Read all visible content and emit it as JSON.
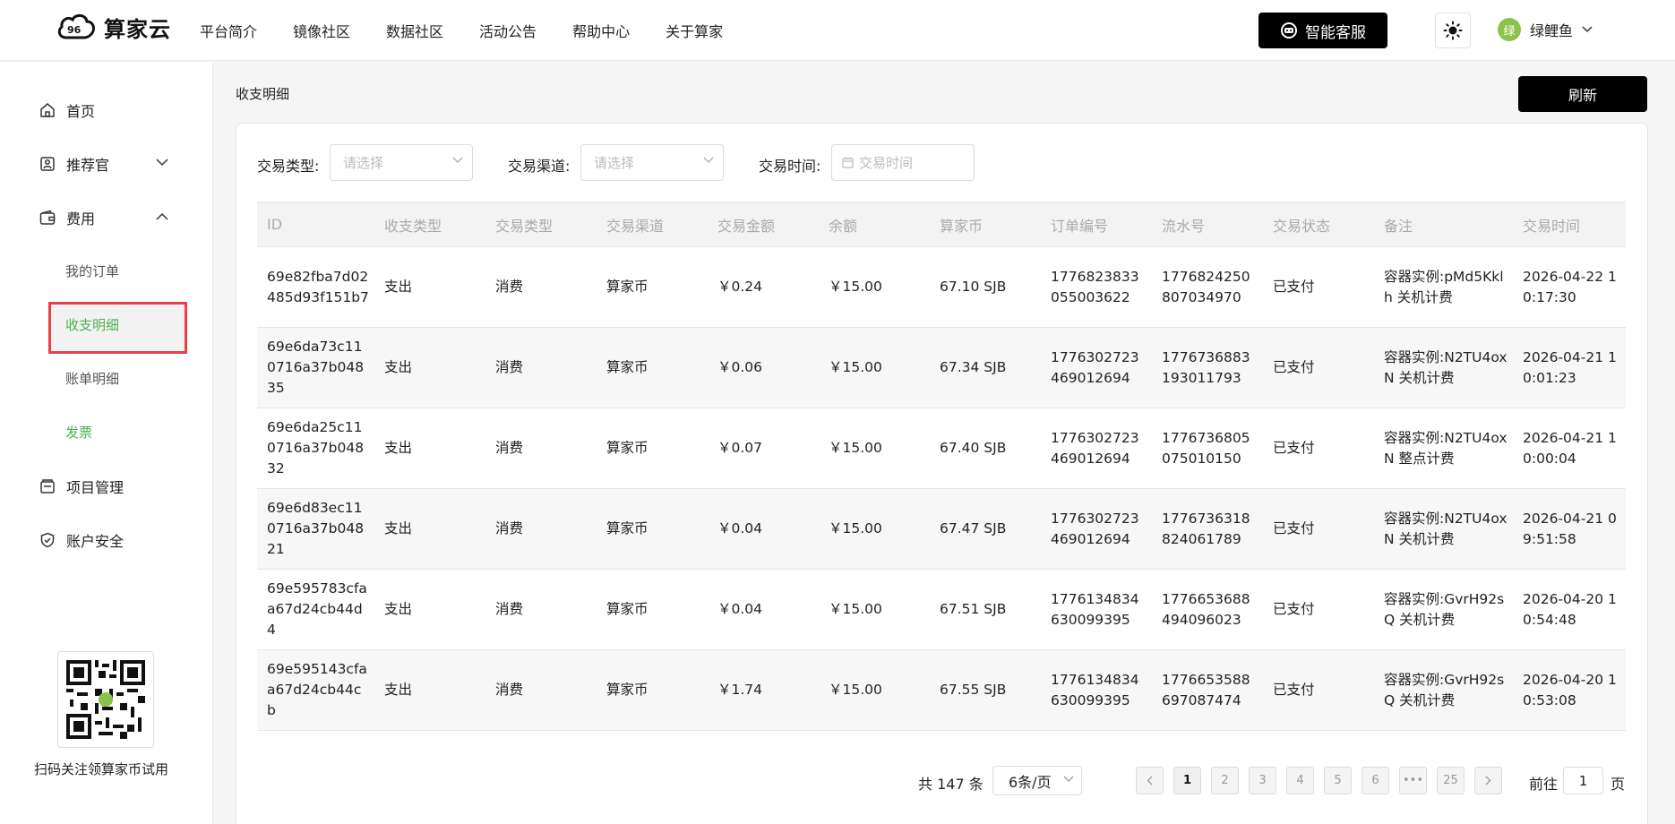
{
  "brand": {
    "name": "算家云"
  },
  "topnav": [
    "平台简介",
    "镜像社区",
    "数据社区",
    "活动公告",
    "帮助中心",
    "关于算家"
  ],
  "header": {
    "ai_service": "智能客服",
    "username": "绿鲤鱼",
    "avatar_text": "绿"
  },
  "sidebar": {
    "home": "首页",
    "recommender": "推荐官",
    "fees": "费用",
    "sub": {
      "orders": "我的订单",
      "income": "收支明细",
      "bills": "账单明细",
      "invoice": "发票"
    },
    "projects": "项目管理",
    "security": "账户安全",
    "qr_caption": "扫码关注领算家币试用"
  },
  "page": {
    "breadcrumb": "收支明细",
    "refresh": "刷新"
  },
  "filters": {
    "type_label": "交易类型:",
    "type_placeholder": "请选择",
    "channel_label": "交易渠道:",
    "channel_placeholder": "请选择",
    "time_label": "交易时间:",
    "time_placeholder": "交易时间"
  },
  "table": {
    "headers": [
      "ID",
      "收支类型",
      "交易类型",
      "交易渠道",
      "交易金额",
      "余额",
      "算家币",
      "订单编号",
      "流水号",
      "交易状态",
      "备注",
      "交易时间"
    ],
    "rows": [
      [
        "69e82fba7d02485d93f151b7",
        "支出",
        "消费",
        "算家币",
        "￥0.24",
        "￥15.00",
        "67.10 SJB",
        "1776823833055003622",
        "1776824250807034970",
        "已支付",
        "容器实例:pMd5Kklh 关机计费",
        "2026-04-22 10:17:30"
      ],
      [
        "69e6da73c110716a37b04835",
        "支出",
        "消费",
        "算家币",
        "￥0.06",
        "￥15.00",
        "67.34 SJB",
        "1776302723469012694",
        "1776736883193011793",
        "已支付",
        "容器实例:N2TU4oxN 关机计费",
        "2026-04-21 10:01:23"
      ],
      [
        "69e6da25c110716a37b04832",
        "支出",
        "消费",
        "算家币",
        "￥0.07",
        "￥15.00",
        "67.40 SJB",
        "1776302723469012694",
        "1776736805075010150",
        "已支付",
        "容器实例:N2TU4oxN 整点计费",
        "2026-04-21 10:00:04"
      ],
      [
        "69e6d83ec110716a37b04821",
        "支出",
        "消费",
        "算家币",
        "￥0.04",
        "￥15.00",
        "67.47 SJB",
        "1776302723469012694",
        "1776736318824061789",
        "已支付",
        "容器实例:N2TU4oxN 关机计费",
        "2026-04-21 09:51:58"
      ],
      [
        "69e595783cfaa67d24cb44d4",
        "支出",
        "消费",
        "算家币",
        "￥0.04",
        "￥15.00",
        "67.51 SJB",
        "1776134834630099395",
        "1776653688494096023",
        "已支付",
        "容器实例:GvrH92sQ 关机计费",
        "2026-04-20 10:54:48"
      ],
      [
        "69e595143cfaa67d24cb44cb",
        "支出",
        "消费",
        "算家币",
        "￥1.74",
        "￥15.00",
        "67.55 SJB",
        "1776134834630099395",
        "1776653588697087474",
        "已支付",
        "容器实例:GvrH92sQ 关机计费",
        "2026-04-20 10:53:08"
      ]
    ]
  },
  "pagination": {
    "total": "共 147 条",
    "page_size": "6条/页",
    "pages": [
      "1",
      "2",
      "3",
      "4",
      "5",
      "6",
      "•••",
      "25"
    ],
    "goto_prefix": "前往",
    "goto_value": "1",
    "goto_suffix": "页"
  },
  "colors": {
    "accent": "#4caf50",
    "highlight_border": "#e8404a",
    "primary_button": "#000000"
  }
}
